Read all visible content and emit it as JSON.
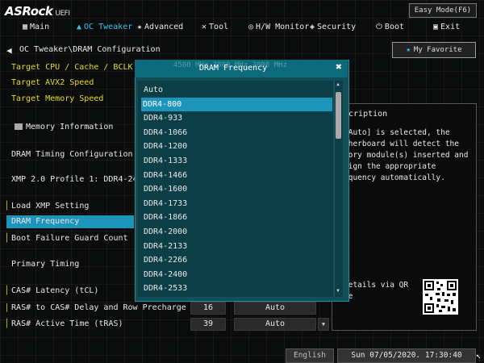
{
  "brand": {
    "logo": "ASRock",
    "logo_suffix": "UEFI"
  },
  "easy_mode_label": "Easy Mode(F6)",
  "tabs": [
    {
      "label": "Main",
      "icon": "grid-icon"
    },
    {
      "label": "OC Tweaker",
      "icon": "flame-icon"
    },
    {
      "label": "Advanced",
      "icon": "star-icon"
    },
    {
      "label": "Tool",
      "icon": "tool-icon"
    },
    {
      "label": "H/W Monitor",
      "icon": "monitor-icon"
    },
    {
      "label": "Security",
      "icon": "shield-icon"
    },
    {
      "label": "Boot",
      "icon": "power-icon"
    },
    {
      "label": "Exit",
      "icon": "exit-icon"
    }
  ],
  "breadcrumb": "OC Tweaker\\DRAM Configuration",
  "my_favorite_label": "My Favorite",
  "settings": {
    "target_cpu": "Target CPU / Cache / BCLK Speed",
    "target_avx2": "Target AVX2 Speed",
    "target_memory": "Target Memory Speed",
    "memory_information": "Memory Information",
    "dram_timing_configuration": "DRAM Timing Configuration",
    "xmp_profile": "XMP 2.0 Profile 1: DDR4-2400 16-",
    "load_xmp": "Load XMP Setting",
    "dram_frequency": "DRAM Frequency",
    "boot_failure_guard_count": "Boot Failure Guard Count",
    "primary_timing": "Primary Timing",
    "cas_latency": "CAS# Latency (tCL)",
    "ras_to_cas": "RAS# to CAS# Delay and Row Precharge (tRCDtRP)",
    "ras_active": "RAS# Active Time (tRAS)"
  },
  "fields": {
    "ras_to_cas_value": "16",
    "ras_to_cas_mode": "Auto",
    "ras_active_value": "39",
    "ras_active_mode": "Auto"
  },
  "description": {
    "title": "scription",
    "text": "[Auto] is selected, the therboard will detect the mory module(s) inserted and sign the appropriate equency automatically.",
    "qr_text": "details via QR de"
  },
  "modal": {
    "title": "DRAM Frequency",
    "ghost_text": "4500 MHz     3800 MHz   3000 MHz",
    "selected_index": 1,
    "options": [
      "Auto",
      "DDR4-800",
      "DDR4-933",
      "DDR4-1066",
      "DDR4-1200",
      "DDR4-1333",
      "DDR4-1466",
      "DDR4-1600",
      "DDR4-1733",
      "DDR4-1866",
      "DDR4-2000",
      "DDR4-2133",
      "DDR4-2266",
      "DDR4-2400",
      "DDR4-2533"
    ]
  },
  "footer": {
    "language": "English",
    "datetime": "Sun 07/05/2020. 17:30:40"
  },
  "colors": {
    "accent": "#1d95ba",
    "yellow_text": "#e8dc22",
    "modal_bg": "#114e58"
  }
}
